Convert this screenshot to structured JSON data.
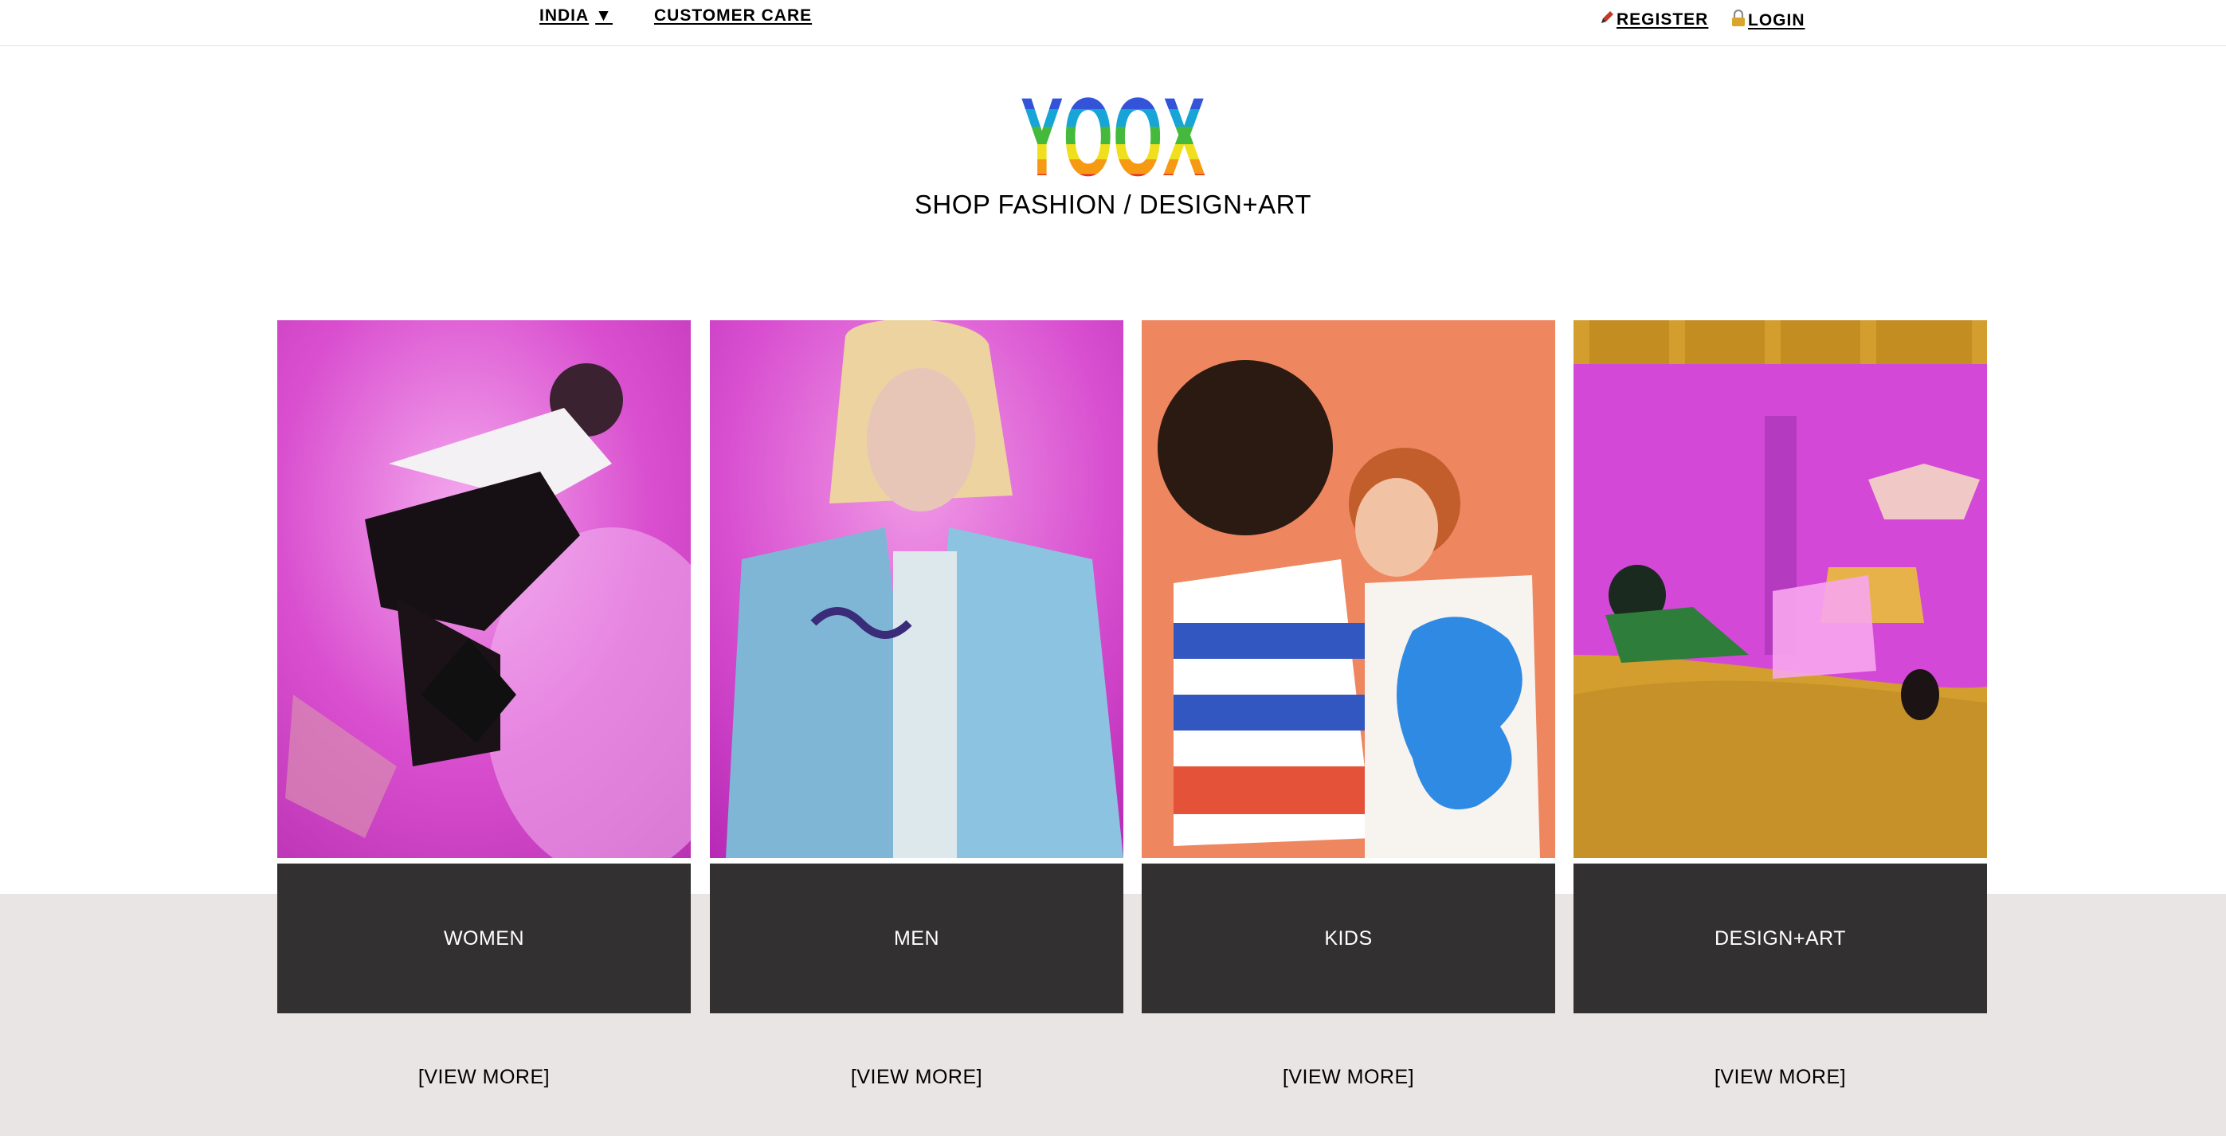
{
  "header": {
    "country": "INDIA",
    "country_caret": "▼",
    "customer_care": "CUSTOMER CARE",
    "register": "REGISTER",
    "login": "LOGIN",
    "register_icon": "pencil-icon",
    "login_icon": "lock-icon"
  },
  "brand": {
    "logo_text": "YOOX",
    "tagline": "SHOP FASHION / DESIGN+ART",
    "logo_colors": [
      "#6b1fb6",
      "#3353d8",
      "#16a5d6",
      "#45b93c",
      "#f0df1d",
      "#f59a12",
      "#e63325",
      "#7d22a8"
    ]
  },
  "categories": [
    {
      "label": "WOMEN",
      "more": "[VIEW MORE]"
    },
    {
      "label": "MEN",
      "more": "[VIEW MORE]"
    },
    {
      "label": "KIDS",
      "more": "[VIEW MORE]"
    },
    {
      "label": "DESIGN+ART",
      "more": "[VIEW MORE]"
    }
  ],
  "colors": {
    "tile_dark": "#323031",
    "band": "#e9e5e4",
    "accent_pink": "#e04fd0",
    "accent_orange": "#ee8660",
    "accent_mustard": "#d39e2e"
  }
}
